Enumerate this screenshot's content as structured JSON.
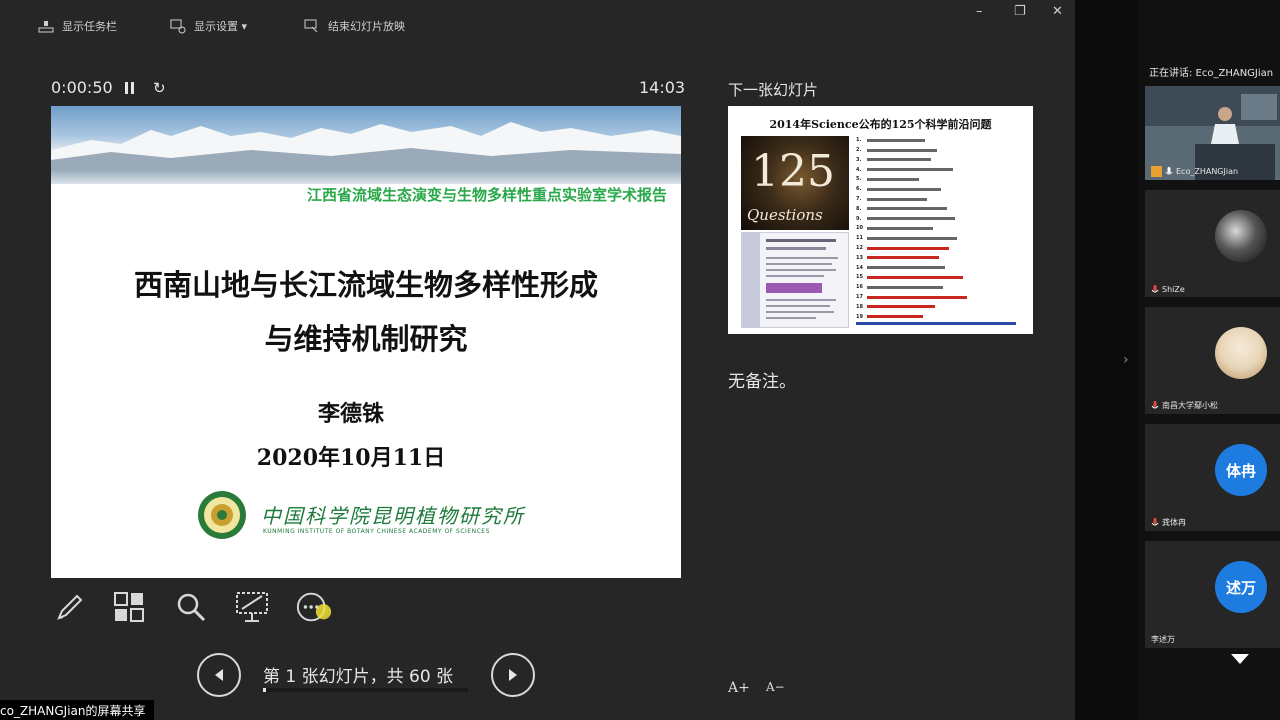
{
  "toolbar": {
    "taskbar_label": "显示任务栏",
    "display_settings_label": "显示设置 ▾",
    "end_show_label": "结束幻灯片放映"
  },
  "timer": {
    "elapsed": "0:00:50",
    "clock": "14:03"
  },
  "current_slide": {
    "lab_line": "江西省流域生态演变与生物多样性重点实验室学术报告",
    "title_line1": "西南山地与长江流域生物多样性形成",
    "title_line2": "与维持机制研究",
    "author": "李德铢",
    "date": "2020年10月11日",
    "institute_cn": "中国科学院昆明植物研究所",
    "institute_en": "KUNMING INSTITUTE OF BOTANY CHINESE ACADEMY OF SCIENCES"
  },
  "navigation": {
    "counter": "第 1 张幻灯片，共 60 张",
    "progress": 0.0167
  },
  "next_slide": {
    "label": "下一张幻灯片",
    "title": "2014年Science公布的125个科学前沿问题",
    "cover_number": "125",
    "cover_word": "Questions"
  },
  "notes": {
    "text": "无备注。"
  },
  "font_controls": {
    "increase": "A+",
    "decrease": "A−"
  },
  "share_label": "co_ZHANGJian的屏幕共享",
  "participants": {
    "speaking": "正在讲话: Eco_ZHANGJian",
    "tiles": [
      {
        "name": "Eco_ZHANGJian"
      },
      {
        "name": "ShiZe"
      },
      {
        "name": "南昌大学鄢小松"
      },
      {
        "name": "龚体冉",
        "avatar_text": "体冉"
      },
      {
        "name": "李述万",
        "avatar_text": "述万"
      }
    ]
  },
  "colors": {
    "accent_green": "#2aa84a",
    "avatar_blue": "#1e7be0",
    "panel": "#262626"
  },
  "icons": [
    "taskbar-icon",
    "display-settings-icon",
    "end-show-icon",
    "pause-icon",
    "restart-icon",
    "pen-icon",
    "grid-icon",
    "zoom-icon",
    "subtitle-icon",
    "more-icon",
    "prev-icon",
    "next-icon",
    "mic-icon",
    "chevron-down-icon"
  ]
}
